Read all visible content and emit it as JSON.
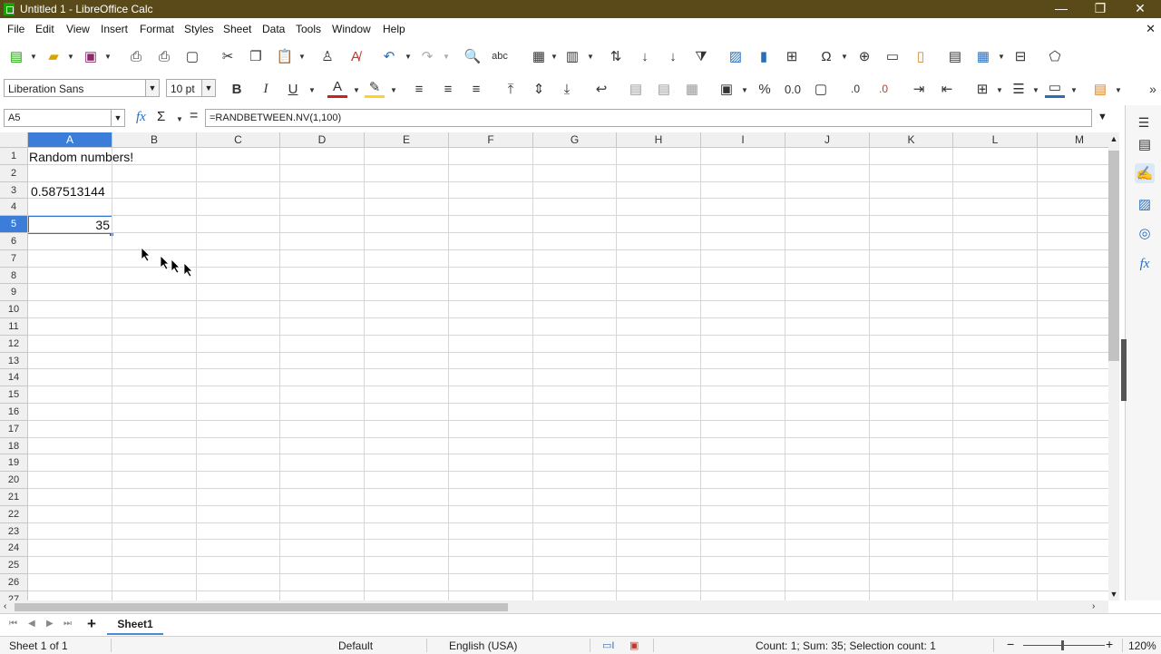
{
  "window": {
    "title": "Untitled 1 - LibreOffice Calc",
    "min": "—",
    "restore": "❐",
    "close": "✕"
  },
  "menu": [
    "File",
    "Edit",
    "View",
    "Insert",
    "Format",
    "Styles",
    "Sheet",
    "Data",
    "Tools",
    "Window",
    "Help"
  ],
  "menu_close": "✕",
  "formatting": {
    "font_name": "Liberation Sans",
    "font_size": "10 pt",
    "bold": "B",
    "italic": "I",
    "underline": "U"
  },
  "formula_bar": {
    "name_box": "A5",
    "fx": "fx",
    "sum": "Σ",
    "equals": "=",
    "formula": "=RANDBETWEEN.NV(1,100)"
  },
  "columns": [
    "A",
    "B",
    "C",
    "D",
    "E",
    "F",
    "G",
    "H",
    "I",
    "J",
    "K",
    "L",
    "M"
  ],
  "rows": [
    "1",
    "2",
    "3",
    "4",
    "5",
    "6",
    "7",
    "8",
    "9",
    "10",
    "11",
    "12",
    "13",
    "14",
    "15",
    "16",
    "17",
    "18",
    "19",
    "20",
    "21",
    "22",
    "23",
    "24",
    "25",
    "26",
    "27"
  ],
  "cells": {
    "A1": "Random numbers!",
    "A3": "0.587513144",
    "A5": "35"
  },
  "selected_cell": "A5",
  "sheet_tabs": [
    "Sheet1"
  ],
  "status": {
    "sheet": "Sheet 1 of 1",
    "page_style": "Default",
    "language": "English (USA)",
    "summary": "Count: 1; Sum: 35; Selection count: 1",
    "zoom": "120%"
  },
  "colors": {
    "titlebar": "#5a4a1a",
    "selection": "#3b7dd8"
  }
}
